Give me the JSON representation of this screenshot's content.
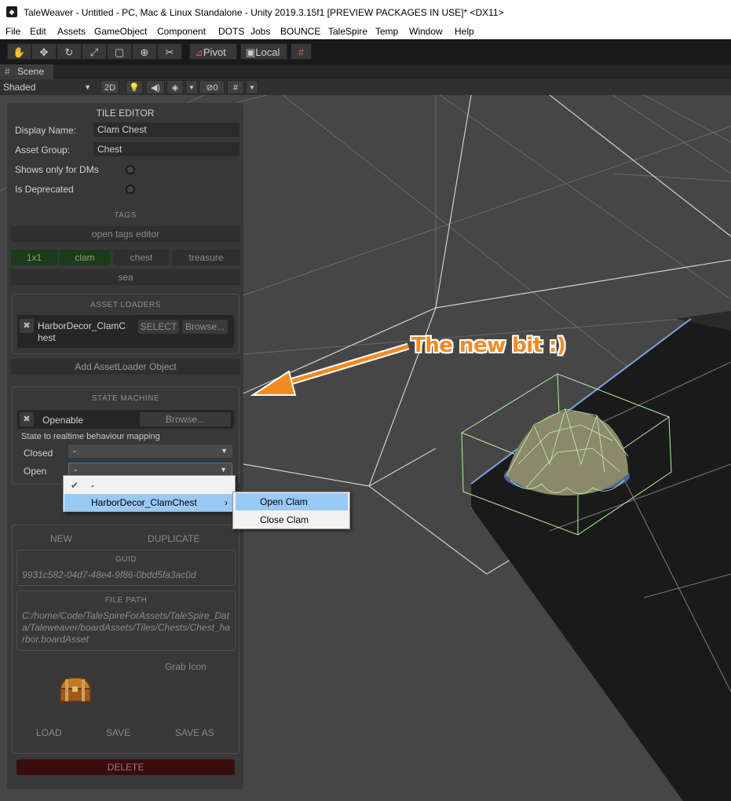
{
  "window": {
    "title": "TaleWeaver - Untitled - PC, Mac & Linux Standalone - Unity 2019.3.15f1 [PREVIEW PACKAGES IN USE]* <DX11>"
  },
  "menubar": {
    "items": [
      "File",
      "Edit",
      "Assets",
      "GameObject",
      "Component",
      "DOTS",
      "Jobs",
      "BOUNCE",
      "TaleSpire",
      "Temp",
      "Window",
      "Help"
    ]
  },
  "toolbar": {
    "pivot_label": "Pivot",
    "local_label": "Local"
  },
  "scene_tab": {
    "label": "Scene",
    "shading_mode": "Shaded",
    "mode_2d": "2D",
    "hidden_count": "0"
  },
  "annotation": {
    "text": "The new bit :)",
    "color": "#f48a22"
  },
  "tile_editor": {
    "title": "TILE EDITOR",
    "display_name_label": "Display Name:",
    "display_name_value": "Clam Chest",
    "asset_group_label": "Asset Group:",
    "asset_group_value": "Chest",
    "dm_only_label": "Shows only for DMs",
    "deprecated_label": "Is Deprecated",
    "tags_title": "TAGS",
    "open_tags_editor": "open tags editor",
    "tags": [
      "1x1",
      "clam",
      "chest",
      "treasure",
      "sea"
    ],
    "asset_loaders_title": "ASSET LOADERS",
    "loader_name": "HarborDecor_ClamChest",
    "select_label": "SELECT",
    "browse_label": "Browse...",
    "add_asset_loader": "Add AssetLoader Object",
    "state_machine_title": "STATE MACHINE",
    "state_machine_name": "Openable",
    "state_browse_label": "Browse...",
    "mapping_label": "State to realtime behaviour mapping",
    "closed_label": "Closed",
    "closed_value": "-",
    "open_label": "Open",
    "open_value": "-",
    "new_label": "NEW",
    "duplicate_label": "DUPLICATE",
    "guid_title": "GUID",
    "guid_value": "9931c582-04d7-48e4-9f86-0bdd5fa3ac0d",
    "file_path_title": "FILE PATH",
    "file_path_value": "C:/home/Code/TaleSpireForAssets/TaleSpire_Data/Taleweaver/boardAssets/Tiles/Chests/Chest_harbor.boardAsset",
    "grab_icon_label": "Grab Icon",
    "load_label": "LOAD",
    "save_label": "SAVE",
    "save_as_label": "SAVE AS",
    "delete_label": "DELETE"
  },
  "dropdown_menu": {
    "items": [
      "-",
      "HarborDecor_ClamChest"
    ],
    "submenu": [
      "Open Clam",
      "Close Clam"
    ],
    "highlight_color": "#99c9f5"
  }
}
